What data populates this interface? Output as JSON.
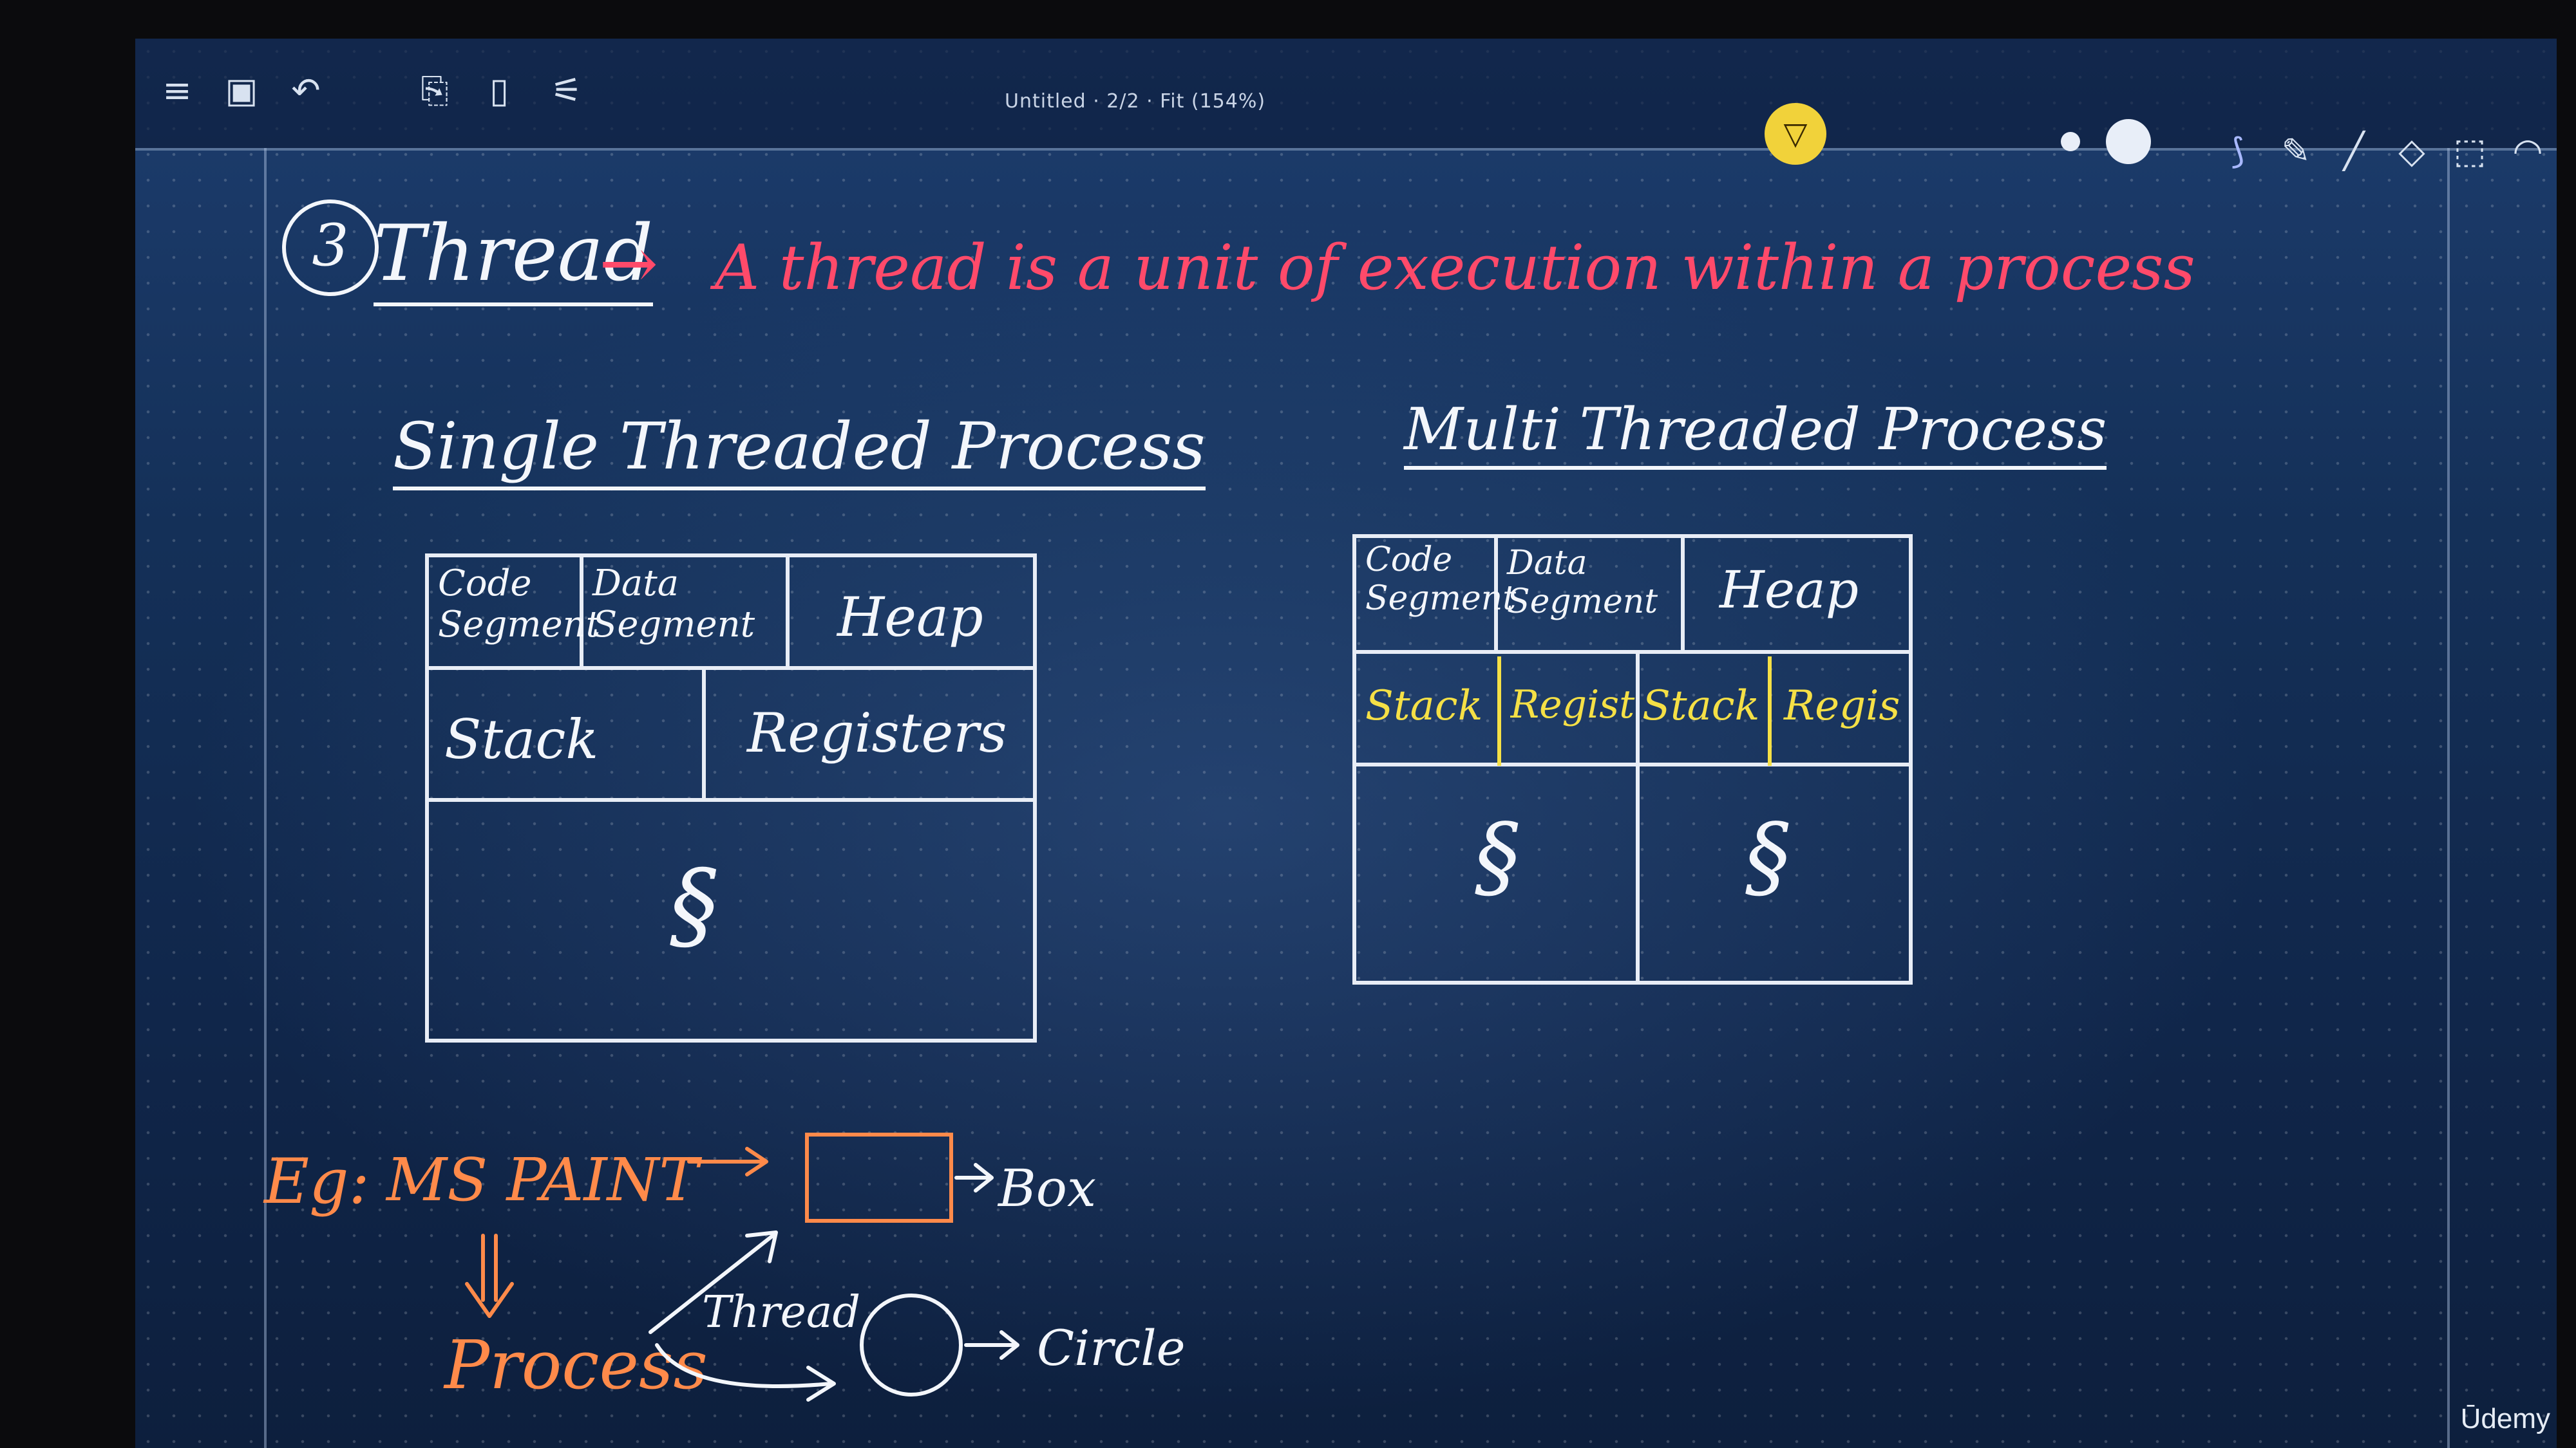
{
  "toolbar": {
    "doc_title": "Untitled · 2/2 · Fit (154%)",
    "icons": [
      "menu-icon",
      "save-icon",
      "undo-icon",
      "clipboard-icon",
      "page-icon",
      "settings-sliders-icon"
    ],
    "right_tools": [
      "lasso-icon",
      "pencil-icon",
      "line-icon",
      "eraser-icon",
      "select-icon",
      "eye-icon"
    ]
  },
  "heading": {
    "number": "3",
    "title": "Thread",
    "arrow": "→",
    "definition": "A thread is a unit of execution within a process"
  },
  "single": {
    "title": "Single Threaded Process",
    "code": "Code Segment",
    "data": "Data Segment",
    "heap": "Heap",
    "stack": "Stack",
    "registers": "Registers",
    "squiggle": "§"
  },
  "multi": {
    "title": "Multi Threaded Process",
    "code": "Code Segment",
    "data": "Data Segment",
    "heap": "Heap",
    "stack1": "Stack",
    "reg1": "Registers",
    "stack2": "Stack",
    "reg2": "Regis",
    "squiggle1": "§",
    "squiggle2": "§"
  },
  "example": {
    "eg": "Eg:",
    "app": "MS PAINT",
    "process": "Process",
    "thread": "Thread",
    "box_label": "Box",
    "circle_label": "Circle"
  },
  "watermark": "Ūdemy"
}
